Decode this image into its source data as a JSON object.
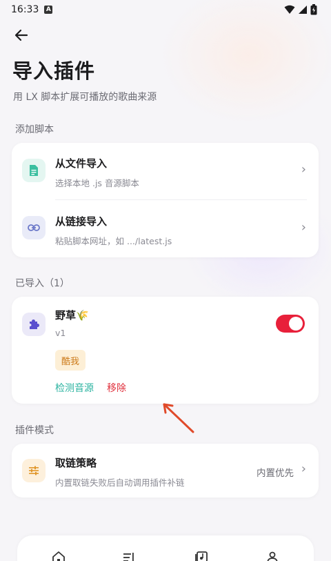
{
  "status_bar": {
    "time": "16:33",
    "notification_letter": "A"
  },
  "header": {
    "title": "导入插件",
    "subtitle": "用 LX 脚本扩展可播放的歌曲来源"
  },
  "add_script": {
    "section_label": "添加脚本",
    "items": [
      {
        "title": "从文件导入",
        "subtitle": "选择本地 .js 音源脚本",
        "icon": "file-icon",
        "icon_color": "#3bbfa0",
        "icon_bg": "#e4f6f1"
      },
      {
        "title": "从链接导入",
        "subtitle": "粘贴脚本网址，如 .../latest.js",
        "icon": "link-icon",
        "icon_color": "#6b78c9",
        "icon_bg": "#e9ebf8"
      }
    ]
  },
  "imported": {
    "section_label": "已导入（1）",
    "plugin": {
      "name": "野草🌾",
      "version": "v1",
      "tag": "酷我",
      "enabled": true,
      "check_label": "检测音源",
      "remove_label": "移除",
      "icon": "puzzle-icon",
      "icon_color": "#5a4fcf",
      "icon_bg": "#ebe9f8"
    }
  },
  "plugin_mode": {
    "section_label": "插件模式",
    "item": {
      "title": "取链策略",
      "subtitle": "内置取链失败后自动调用插件补链",
      "value": "内置优先",
      "icon": "sliders-icon",
      "icon_color": "#e0962a",
      "icon_bg": "#fdf0dc"
    }
  },
  "colors": {
    "accent_red": "#e8203a",
    "link_teal": "#2bb3a0",
    "remove_red": "#e0303c"
  },
  "bottom_nav": [
    "home-icon",
    "playlist-icon",
    "library-icon",
    "profile-icon"
  ]
}
